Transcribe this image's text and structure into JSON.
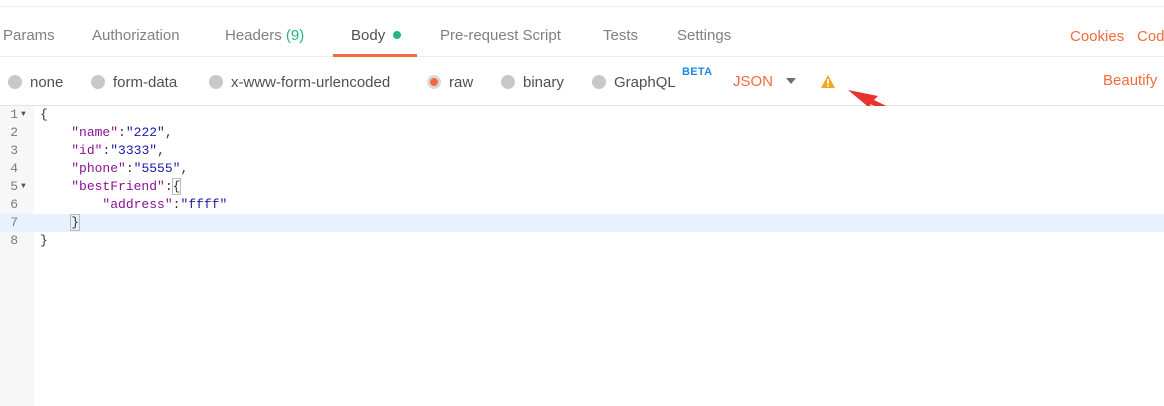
{
  "tabs": [
    {
      "label": "Params"
    },
    {
      "label": "Authorization"
    },
    {
      "label": "Headers",
      "count": "(9)"
    },
    {
      "label": "Body"
    },
    {
      "label": "Pre-request Script"
    },
    {
      "label": "Tests"
    },
    {
      "label": "Settings"
    }
  ],
  "right_links": {
    "cookies": "Cookies",
    "code": "Code"
  },
  "body_types": [
    {
      "label": "none",
      "selected": false
    },
    {
      "label": "form-data",
      "selected": false
    },
    {
      "label": "x-www-form-urlencoded",
      "selected": false
    },
    {
      "label": "raw",
      "selected": true
    },
    {
      "label": "binary",
      "selected": false
    },
    {
      "label": "GraphQL",
      "selected": false
    }
  ],
  "beta_badge": "BETA",
  "format_select": "JSON",
  "beautify": "Beautify",
  "colors": {
    "accent": "#f26b3a",
    "success": "#26b47f",
    "beta": "#1e88e5",
    "warning": "#f5a623",
    "annotation_arrow": "#e8322d"
  },
  "icons": {
    "warning": "warning-icon",
    "caret": "chevron-down-icon",
    "annotation": "red-arrow-icon"
  },
  "editor": {
    "line_numbers": [
      "1",
      "2",
      "3",
      "4",
      "5",
      "6",
      "7",
      "8"
    ],
    "lines": [
      {
        "k": "",
        "s": "",
        "p": "{"
      },
      {
        "k": "\"name\"",
        "s": "\"222\"",
        "p": ","
      },
      {
        "k": "\"id\"",
        "s": "\"3333\"",
        "p": ","
      },
      {
        "k": "\"phone\"",
        "s": "\"5555\"",
        "p": ","
      },
      {
        "k": "\"bestFriend\"",
        "s": "",
        "p": "{"
      },
      {
        "k": "\"address\"",
        "s": "\"ffff\"",
        "p": ""
      },
      {
        "k": "",
        "s": "",
        "p": "}"
      },
      {
        "k": "",
        "s": "",
        "p": "}"
      }
    ],
    "highlighted_line": "7"
  }
}
